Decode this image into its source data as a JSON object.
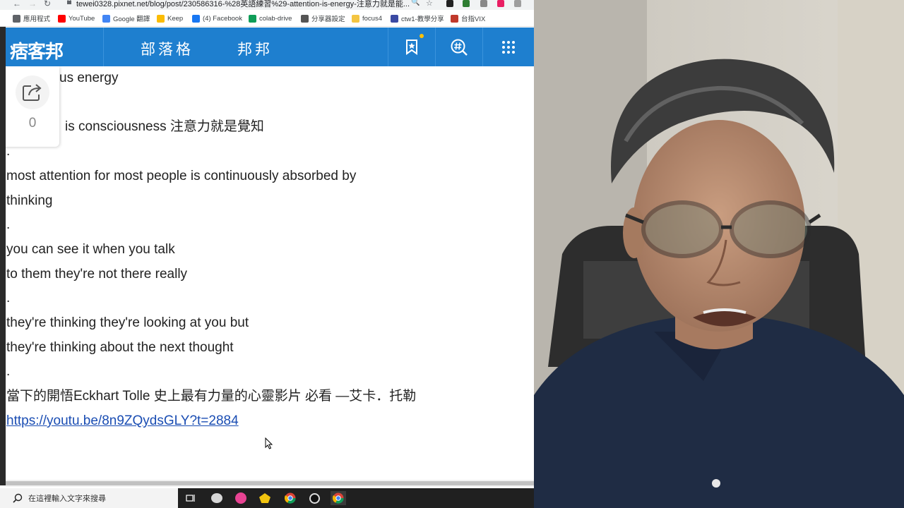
{
  "browser": {
    "url": "tewei0328.pixnet.net/blog/post/230586316-%28英語練習%29-attention-is-energy-注意力就是能...",
    "bookmarks": [
      {
        "label": "應用程式",
        "icon": "apps-grid-icon",
        "color": "#5f6368"
      },
      {
        "label": "YouTube",
        "icon": "youtube-icon",
        "color": "#ff0000"
      },
      {
        "label": "Google 翻譯",
        "icon": "google-translate-icon",
        "color": "#4285f4"
      },
      {
        "label": "Keep",
        "icon": "keep-icon",
        "color": "#fbbc04"
      },
      {
        "label": "(4) Facebook",
        "icon": "facebook-icon",
        "color": "#1877f2"
      },
      {
        "label": "colab-drive",
        "icon": "drive-icon",
        "color": "#0f9d58"
      },
      {
        "label": "分享器設定",
        "icon": "router-icon",
        "color": "#555555"
      },
      {
        "label": "focus4",
        "icon": "folder-icon",
        "color": "#f4c542"
      },
      {
        "label": "ctw1-教學分享",
        "icon": "bookmark-site-icon",
        "color": "#3b4aa3"
      },
      {
        "label": "台指VIX",
        "icon": "w-site-icon",
        "color": "#c0392b"
      }
    ]
  },
  "site": {
    "logo_text": "痞客邦",
    "nav": [
      "部落格",
      "邦邦"
    ],
    "brand_color": "#1e7fcf"
  },
  "share": {
    "count": "0"
  },
  "article": {
    "lines": [
      "us energy",
      "is consciousness 注意力就是覺知",
      ".",
      "most attention for most people is continuously absorbed by",
      "thinking",
      ".",
      "you can see it when you talk",
      "to them they're not there really",
      ".",
      "they're thinking they're looking at you but",
      "they're thinking about the next thought",
      ".",
      "當下的開悟Eckhart Tolle 史上最有力量的心靈影片 必看 —艾卡．托勒"
    ],
    "link": "https://youtu.be/8n9ZQydsGLY?t=2884"
  },
  "taskbar": {
    "search_placeholder": "在這裡輸入文字來搜尋"
  }
}
